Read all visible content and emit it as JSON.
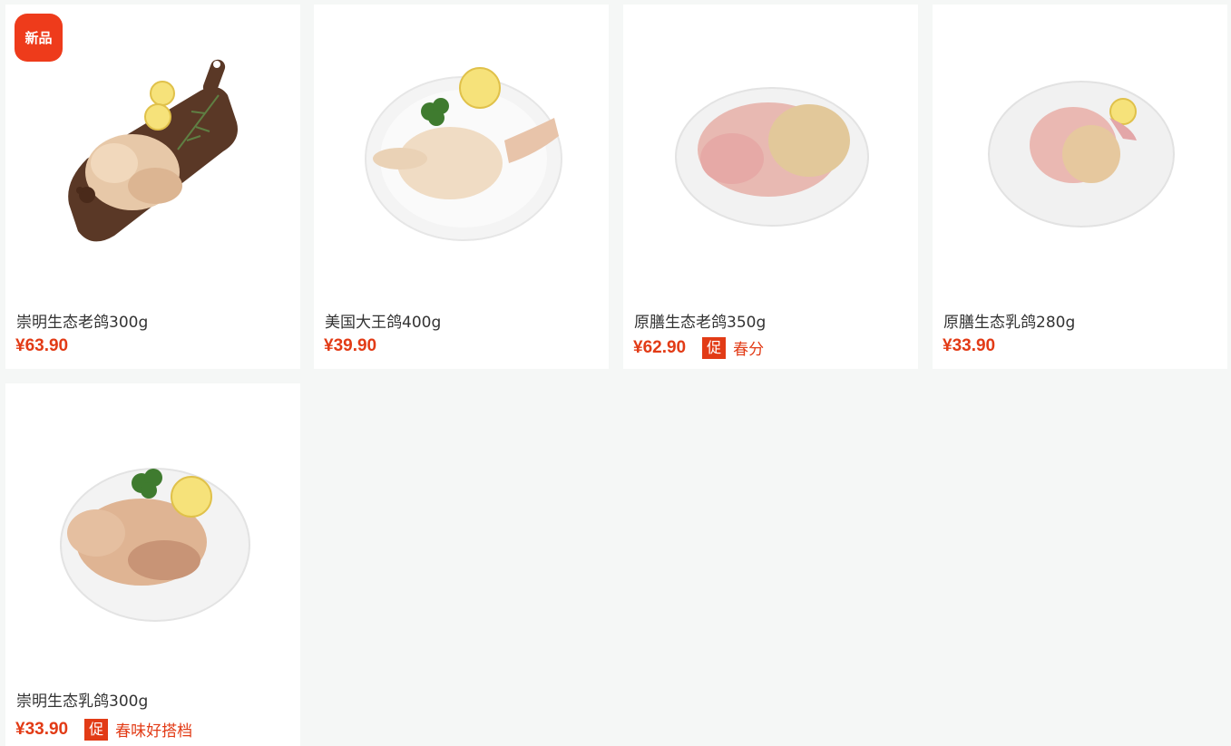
{
  "products": [
    {
      "name": "崇明生态老鸽300g",
      "price": "¥63.90",
      "badge": "新品"
    },
    {
      "name": "美国大王鸽400g",
      "price": "¥39.90"
    },
    {
      "name": "原膳生态老鸽350g",
      "price": "¥62.90",
      "promo_tag": "促",
      "promo_text": "春分"
    },
    {
      "name": "原膳生态乳鸽280g",
      "price": "¥33.90"
    },
    {
      "name": "崇明生态乳鸽300g",
      "price": "¥33.90",
      "promo_tag": "促",
      "promo_text": "春味好搭档"
    }
  ],
  "colors": {
    "accent": "#e23b16",
    "badge": "#ee3b1b",
    "background": "#f5f7f6"
  }
}
